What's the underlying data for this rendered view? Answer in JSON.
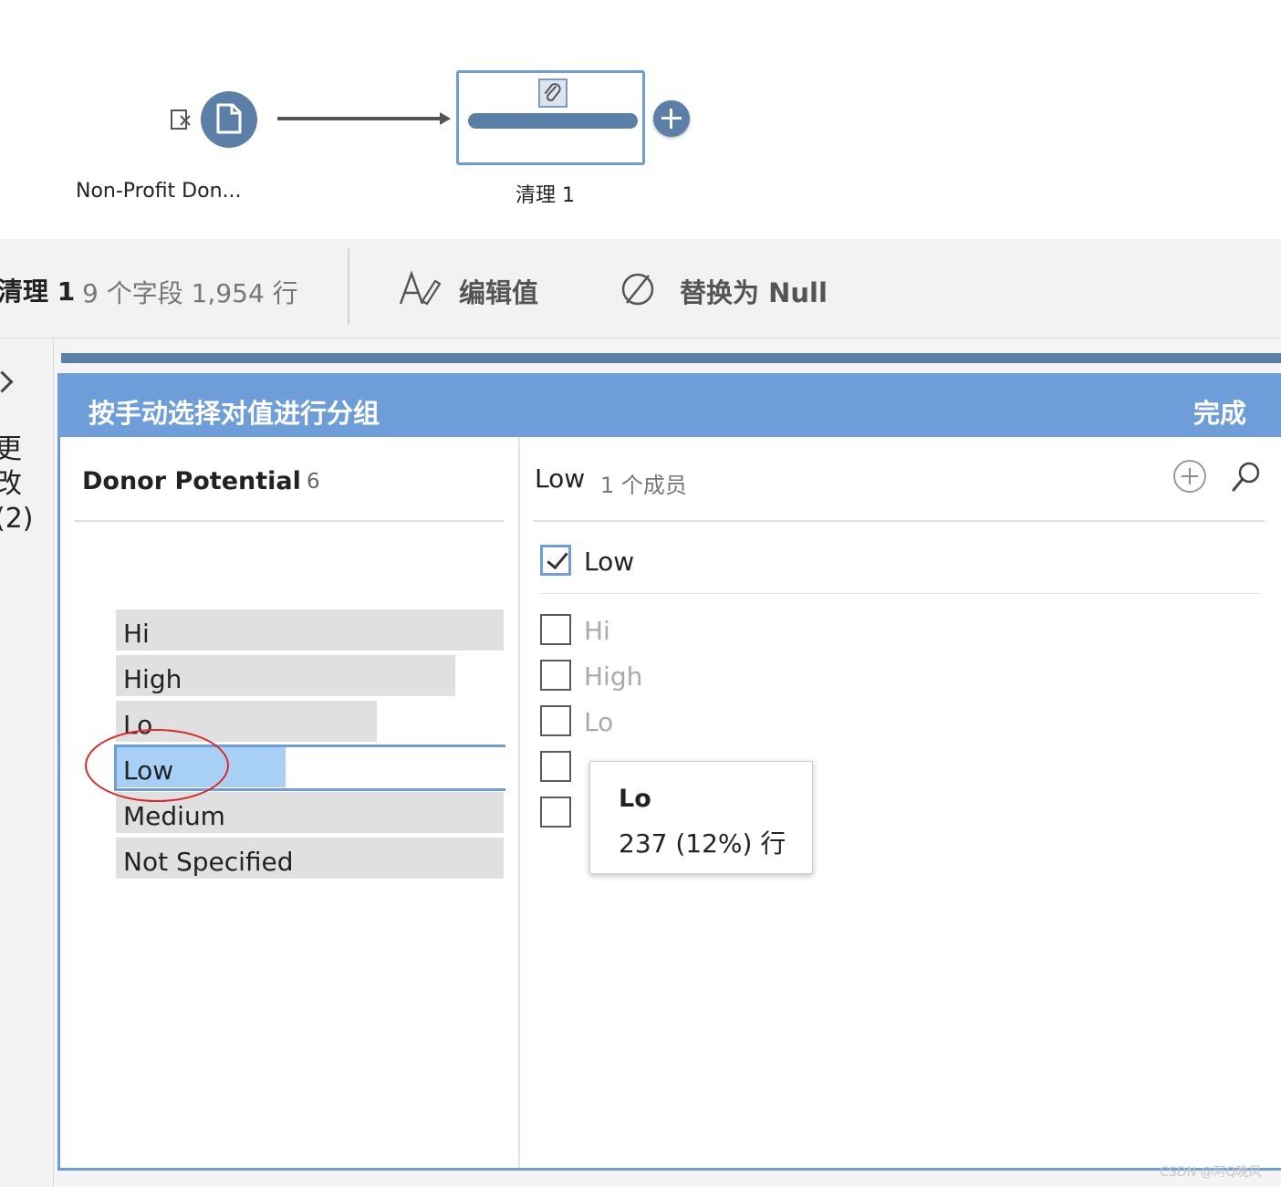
{
  "flow": {
    "input_node_label": "Non-Profit Don...",
    "clean_node_label": "清理 1",
    "icons": [
      "input-source-icon",
      "document-icon",
      "paperclip-icon",
      "add-step-icon"
    ]
  },
  "toolbar": {
    "step_name": "清理 1",
    "stats": "9 个字段  1,954 行",
    "edit_values_label": "编辑值",
    "replace_null_label": "替换为 Null"
  },
  "side_panel": {
    "changes_label": "更改 (2)"
  },
  "dialog": {
    "title": "按手动选择对值进行分组",
    "done_label": "完成",
    "left": {
      "field_name": "Donor Potential",
      "value_count": "6",
      "values": [
        {
          "label": "Hi",
          "bar_fraction": 1.0,
          "selected": false
        },
        {
          "label": "High",
          "bar_fraction": 0.875,
          "selected": false
        },
        {
          "label": "Lo",
          "bar_fraction": 0.672,
          "selected": false
        },
        {
          "label": "Low",
          "bar_fraction": 0.438,
          "selected": true
        },
        {
          "label": "Medium",
          "bar_fraction": 1.0,
          "selected": false
        },
        {
          "label": "Not Specified",
          "bar_fraction": 1.0,
          "selected": false
        }
      ]
    },
    "right": {
      "group_name": "Low",
      "member_count": "1 个成员",
      "members": [
        {
          "label": "Low",
          "checked": true
        }
      ],
      "candidates": [
        {
          "label": "Hi",
          "checked": false
        },
        {
          "label": "High",
          "checked": false
        },
        {
          "label": "Lo",
          "checked": false
        },
        {
          "label": "",
          "checked": false
        },
        {
          "label": "",
          "checked": false
        }
      ]
    }
  },
  "tooltip": {
    "title": "Lo",
    "body": "237 (12%) 行"
  },
  "watermark": "CSDN @阿Q晚风",
  "colors": {
    "accent": "#6d9eda",
    "node": "#5b7fa6",
    "selected_bar": "#a8d0f5",
    "bar": "#e0e0e0",
    "annotation": "#e02525"
  }
}
